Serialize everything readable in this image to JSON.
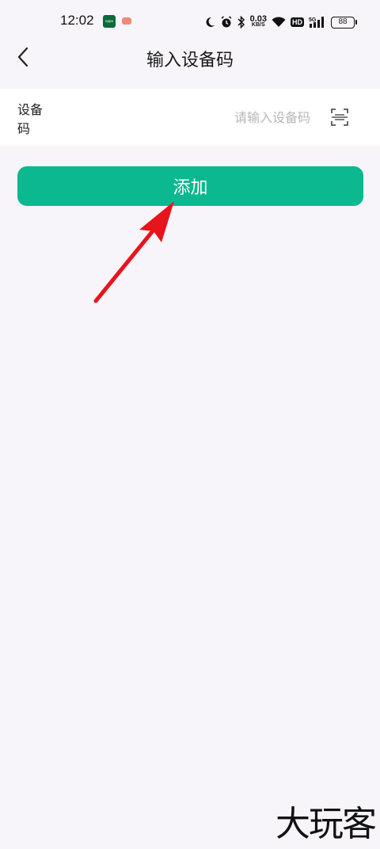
{
  "status_bar": {
    "time": "12:02",
    "app_icon_text": "oppo",
    "net_speed_value": "0.03",
    "net_speed_unit": "KB/S",
    "hd_label": "HD",
    "network_label": "5G",
    "battery": "88",
    "icons": [
      "moon-icon",
      "alarm-icon",
      "bluetooth-icon",
      "wifi-icon",
      "signal-icon"
    ]
  },
  "nav": {
    "title": "输入设备码",
    "back_icon": "chevron-left-icon"
  },
  "form": {
    "label": "设备码",
    "input_value": "",
    "placeholder": "请输入设备码",
    "scan_icon": "scan-icon"
  },
  "actions": {
    "add_label": "添加",
    "accent_color": "#0bb88f"
  },
  "annotation": {
    "color": "#e8141c"
  },
  "watermark": {
    "text": "大玩客"
  }
}
